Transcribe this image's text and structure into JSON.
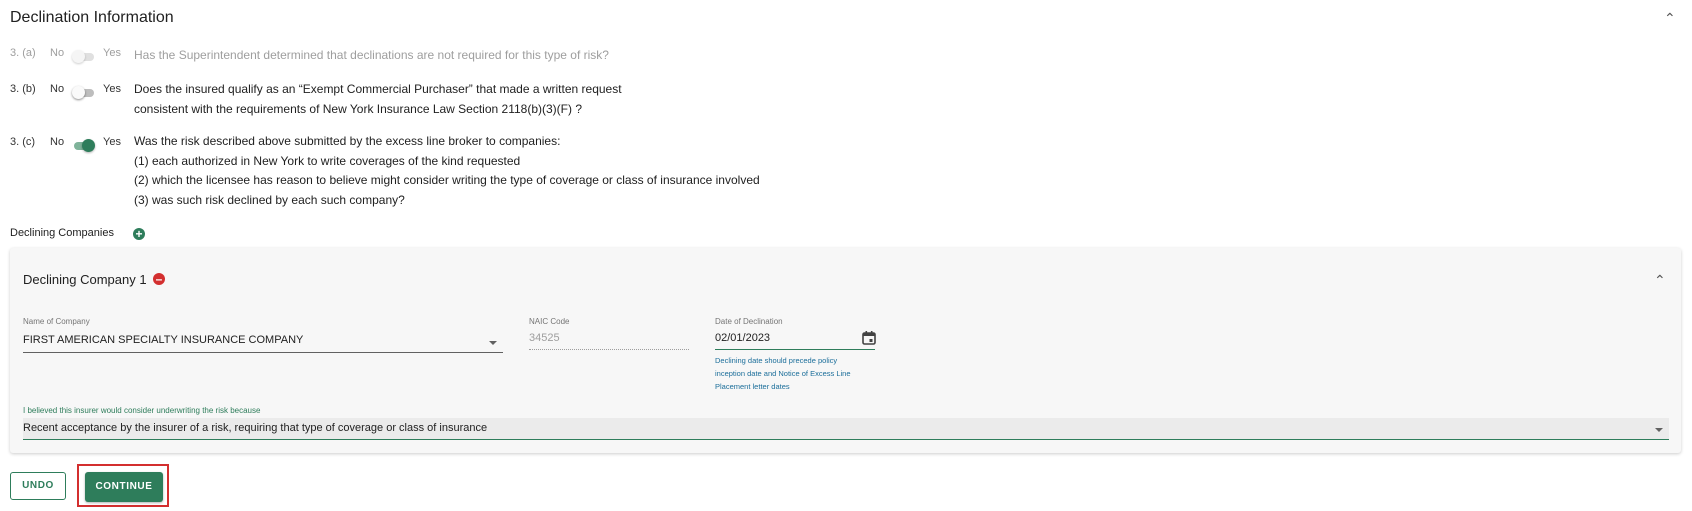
{
  "section": {
    "title": "Declination Information"
  },
  "questions": [
    {
      "num": "3. (a)",
      "no": "No",
      "yes": "Yes",
      "state": "off",
      "disabled": true,
      "lines": [
        "Has the Superintendent determined that declinations are not required for this type of risk?"
      ]
    },
    {
      "num": "3. (b)",
      "no": "No",
      "yes": "Yes",
      "state": "off",
      "disabled": false,
      "lines": [
        "Does the insured qualify as an “Exempt Commercial Purchaser” that made a written request",
        "consistent with the requirements of New York Insurance Law Section 2118(b)(3)(F) ?"
      ]
    },
    {
      "num": "3. (c)",
      "no": "No",
      "yes": "Yes",
      "state": "on",
      "disabled": false,
      "lines": [
        "Was the risk described above submitted by the excess line broker to companies:",
        "(1) each authorized in New York to write coverages of the kind requested",
        "(2) which the licensee has reason to believe might consider writing the type of coverage or class of insurance involved",
        "(3) was such risk declined by each such company?"
      ]
    }
  ],
  "declining": {
    "label": "Declining Companies",
    "company": {
      "title": "Declining Company 1",
      "name_label": "Name of Company",
      "name_value": "FIRST AMERICAN SPECIALTY INSURANCE COMPANY",
      "naic_label": "NAIC Code",
      "naic_value": "34525",
      "date_label": "Date of Declination",
      "date_value": "02/01/2023",
      "date_hint": [
        "Declining date should precede policy",
        "inception date and Notice of Excess Line",
        "Placement letter dates"
      ],
      "reason_label": "I believed this insurer would consider underwriting the risk because",
      "reason_value": "Recent acceptance by the insurer of a risk, requiring that type of coverage or class of insurance"
    }
  },
  "buttons": {
    "undo": "UNDO",
    "continue": "CONTINUE"
  },
  "colors": {
    "accent": "#2e7d5b",
    "danger": "#d32f2f",
    "hint": "#1b6e9a"
  }
}
